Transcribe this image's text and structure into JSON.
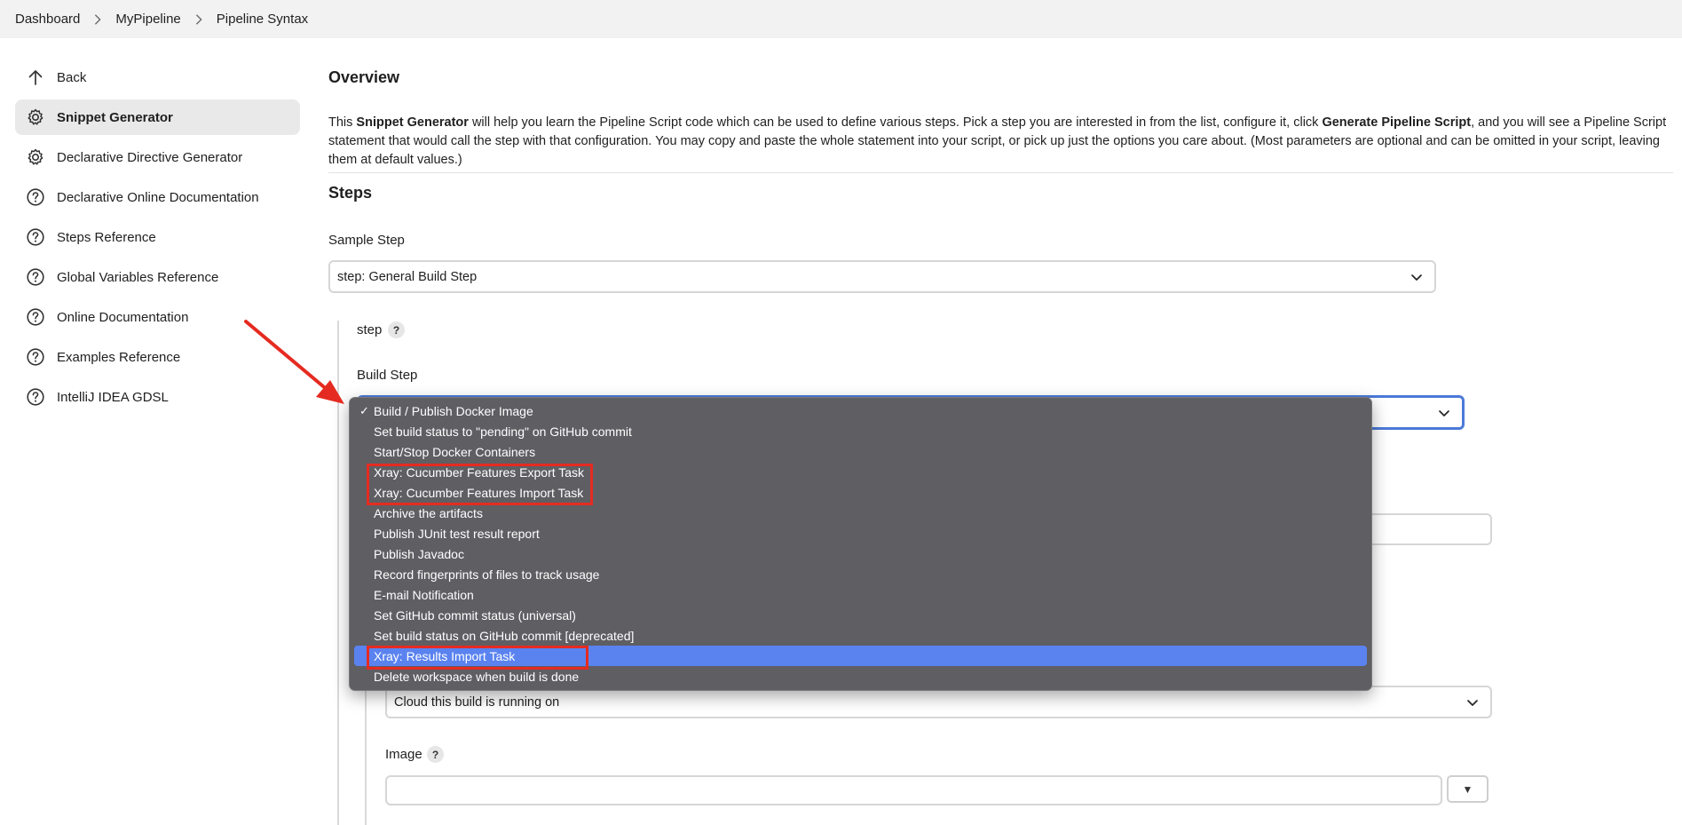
{
  "breadcrumb": [
    "Dashboard",
    "MyPipeline",
    "Pipeline Syntax"
  ],
  "sidebar": {
    "items": [
      {
        "label": "Back",
        "icon": "arrow-up-icon",
        "active": false
      },
      {
        "label": "Snippet Generator",
        "icon": "gear-icon",
        "active": true
      },
      {
        "label": "Declarative Directive Generator",
        "icon": "gear-icon",
        "active": false
      },
      {
        "label": "Declarative Online Documentation",
        "icon": "help-circle-icon",
        "active": false
      },
      {
        "label": "Steps Reference",
        "icon": "help-circle-icon",
        "active": false
      },
      {
        "label": "Global Variables Reference",
        "icon": "help-circle-icon",
        "active": false
      },
      {
        "label": "Online Documentation",
        "icon": "help-circle-icon",
        "active": false
      },
      {
        "label": "Examples Reference",
        "icon": "help-circle-icon",
        "active": false
      },
      {
        "label": "IntelliJ IDEA GDSL",
        "icon": "help-circle-icon",
        "active": false
      }
    ]
  },
  "overview": {
    "title": "Overview",
    "p1": "This ",
    "bold1": "Snippet Generator",
    "p2": " will help you learn the Pipeline Script code which can be used to define various steps. Pick a step you are interested in from the list, configure it, click ",
    "bold2": "Generate Pipeline Script",
    "p3": ", and you will see a Pipeline Script statement that would call the step with that configuration. You may copy and paste the whole statement into your script, or pick up just the options you care about. (Most parameters are optional and can be omitted in your script, leaving them at default values.)"
  },
  "steps": {
    "title": "Steps",
    "sample_step_label": "Sample Step",
    "sample_step_value": "step: General Build Step",
    "step_label": "step",
    "help_glyph": "?",
    "build_step_label": "Build Step",
    "cloud_value": "Cloud this build is running on",
    "image_label": "Image",
    "image_btn": "▼"
  },
  "dropdown": {
    "check_glyph": "✓",
    "options": [
      {
        "label": "Build / Publish Docker Image",
        "checked": true,
        "highlighted": false
      },
      {
        "label": "Set build status to \"pending\" on GitHub commit",
        "checked": false,
        "highlighted": false
      },
      {
        "label": "Start/Stop Docker Containers",
        "checked": false,
        "highlighted": false
      },
      {
        "label": "Xray: Cucumber Features Export Task",
        "checked": false,
        "highlighted": false
      },
      {
        "label": "Xray: Cucumber Features Import Task",
        "checked": false,
        "highlighted": false
      },
      {
        "label": "Archive the artifacts",
        "checked": false,
        "highlighted": false
      },
      {
        "label": "Publish JUnit test result report",
        "checked": false,
        "highlighted": false
      },
      {
        "label": "Publish Javadoc",
        "checked": false,
        "highlighted": false
      },
      {
        "label": "Record fingerprints of files to track usage",
        "checked": false,
        "highlighted": false
      },
      {
        "label": "E-mail Notification",
        "checked": false,
        "highlighted": false
      },
      {
        "label": "Set GitHub commit status (universal)",
        "checked": false,
        "highlighted": false
      },
      {
        "label": "Set build status on GitHub commit [deprecated]",
        "checked": false,
        "highlighted": false
      },
      {
        "label": "Xray: Results Import Task",
        "checked": false,
        "highlighted": true
      },
      {
        "label": "Delete workspace when build is done",
        "checked": false,
        "highlighted": false
      }
    ]
  },
  "colors": {
    "annotation_red": "#e52b21",
    "highlight_blue": "#5a83f0",
    "dropdown_bg": "#5f5e63"
  }
}
